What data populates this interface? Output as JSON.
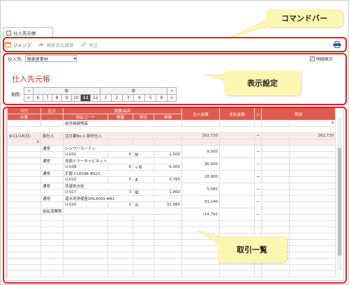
{
  "tab": {
    "label": "仕入先元帳"
  },
  "toolbar": {
    "jump": "ジャンプ",
    "ap_transfer": "買掛支払振替",
    "correct": "修正"
  },
  "filter": {
    "label": "仕入先:",
    "value": "極楽産業材",
    "checkbox_label": "明細表示",
    "checked": true
  },
  "page_title": "仕入先元帳",
  "period": {
    "label": "期間:",
    "year1": "年",
    "year2": "年",
    "prev": "«",
    "next": "»",
    "left": "<",
    "right": ">",
    "months_a": [
      "6",
      "7",
      "8",
      "9",
      "10",
      "11",
      "12"
    ],
    "months_b": [
      "1",
      "2",
      "3",
      "4",
      "5",
      "6"
    ],
    "current": "11"
  },
  "headers": {
    "date": "日付",
    "class": "区分",
    "summary": "摘要/品名",
    "purchase": "仕入金額",
    "payment": "支払金額",
    "flag": "レ",
    "balance": "残高",
    "doc_no": "伝番",
    "item_code": "商品コード",
    "qty": "数量",
    "unit": "単位",
    "price": "単価"
  },
  "rows": {
    "carry": {
      "summary": "前月繰越残高",
      "balance": "0"
    },
    "head": {
      "date": "9/11/18(月)",
      "class": "掛仕入",
      "summary": "注文書No.1 部材仕入",
      "purchase": "162,720",
      "flag": "ー",
      "balance": "162,720",
      "doc": "1"
    },
    "items": [
      {
        "class": "通常",
        "name": "シャワーカーテン",
        "code": "U-001",
        "qty": "6",
        "unit": "枚",
        "price": "1,500",
        "amount": "9,000",
        "flag": "ー"
      },
      {
        "class": "通常",
        "name": "洗面ミラーキャビネット",
        "code": "U-008",
        "qty": "6",
        "unit": "ヶ所",
        "price": "6,000",
        "amount": "36,000",
        "flag": "ー"
      },
      {
        "class": "通常",
        "name": "手摺 CL459B #S21",
        "code": "U-022",
        "qty": "5",
        "unit": "本",
        "price": "3,780",
        "amount": "18,900",
        "flag": "ー"
      },
      {
        "class": "通常",
        "name": "洗濯用水栓",
        "code": "U-017",
        "qty": "3",
        "unit": "個",
        "price": "1,860",
        "amount": "5,580",
        "flag": "ー"
      },
      {
        "class": "通常",
        "name": "温水洗浄便座SHL4000 #B1",
        "code": "U-020",
        "qty": "3",
        "unit": "台",
        "price": "31,080",
        "amount": "93,240",
        "flag": "ー"
      },
      {
        "class": "仮払消費税",
        "name": "",
        "code": "",
        "qty": "",
        "unit": "",
        "price": "",
        "amount": "(14,792",
        "flag": "ー"
      }
    ]
  },
  "callouts": {
    "command_bar": "コマンドバー",
    "display_settings": "表示設定",
    "transactions": "取引一覧"
  }
}
